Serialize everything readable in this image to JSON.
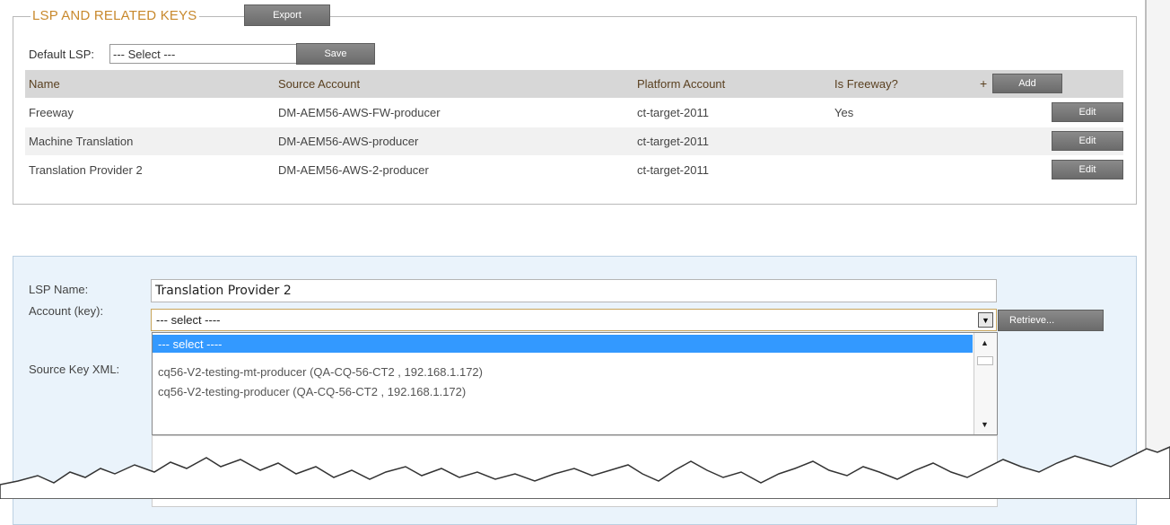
{
  "section": {
    "title": "LSP AND RELATED KEYS",
    "export_label": "Export",
    "default_lsp_label": "Default LSP:",
    "default_lsp_value": "--- Select ---",
    "save_label": "Save"
  },
  "table": {
    "columns": [
      "Name",
      "Source Account",
      "Platform Account",
      "Is Freeway?"
    ],
    "add_plus": "+",
    "add_label": "Add",
    "rows": [
      {
        "name": "Freeway",
        "source": "DM-AEM56-AWS-FW-producer",
        "platform": "ct-target-2011",
        "freeway": "Yes",
        "action": "Edit"
      },
      {
        "name": "Machine Translation",
        "source": "DM-AEM56-AWS-producer",
        "platform": "ct-target-2011",
        "freeway": "",
        "action": "Edit"
      },
      {
        "name": "Translation Provider 2",
        "source": "DM-AEM56-AWS-2-producer",
        "platform": "ct-target-2011",
        "freeway": "",
        "action": "Edit"
      }
    ]
  },
  "form": {
    "lsp_name_label": "LSP Name:",
    "lsp_name_value": "Translation Provider 2",
    "account_label": "Account (key):",
    "account_value": "--- select ----",
    "retrieve_label": "Retrieve...",
    "source_key_label": "Source Key XML:",
    "dropdown_options": [
      "--- select ----",
      "cq56-V2-testing-mt-producer (QA-CQ-56-CT2 , 192.168.1.172)",
      "cq56-V2-testing-producer (QA-CQ-56-CT2 , 192.168.1.172)"
    ]
  },
  "colors": {
    "title_accent": "#c8892d",
    "panel_bg": "#eaf3fb",
    "selection_blue": "#3399ff",
    "button_gray": "#7a7a7a"
  }
}
